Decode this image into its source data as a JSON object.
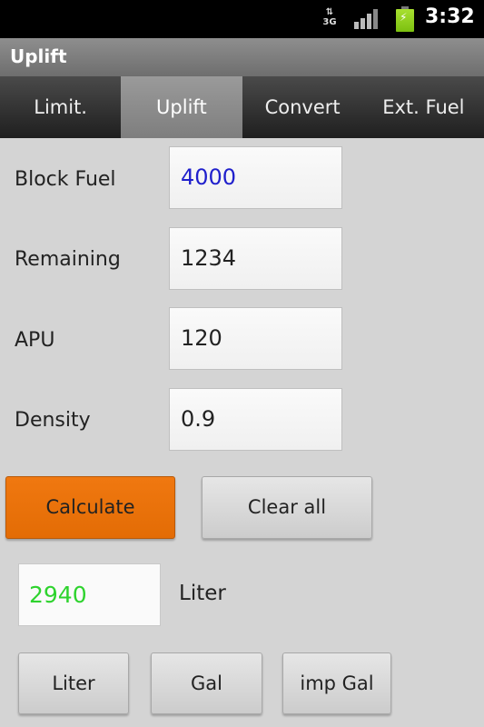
{
  "status_bar": {
    "network": "3G",
    "signal_icon": "signal-bars-icon",
    "battery_icon": "battery-charging-icon",
    "time": "3:32"
  },
  "app": {
    "title": "Uplift"
  },
  "tabs": [
    {
      "label": "Limit.",
      "active": false
    },
    {
      "label": "Uplift",
      "active": true
    },
    {
      "label": "Convert",
      "active": false
    },
    {
      "label": "Ext. Fuel",
      "active": false
    }
  ],
  "form": {
    "block_fuel": {
      "label": "Block Fuel",
      "value": "4000",
      "color": "#2020cc"
    },
    "remaining": {
      "label": "Remaining",
      "value": "1234"
    },
    "apu": {
      "label": "APU",
      "value": "120"
    },
    "density": {
      "label": "Density",
      "value": "0.9"
    }
  },
  "actions": {
    "calculate": "Calculate",
    "clear_all": "Clear all"
  },
  "result": {
    "value": "2940",
    "unit": "Liter",
    "color": "#2ed32e"
  },
  "unit_buttons": [
    "Liter",
    "Gal",
    "imp Gal"
  ],
  "colors": {
    "accent": "#e36c05"
  }
}
